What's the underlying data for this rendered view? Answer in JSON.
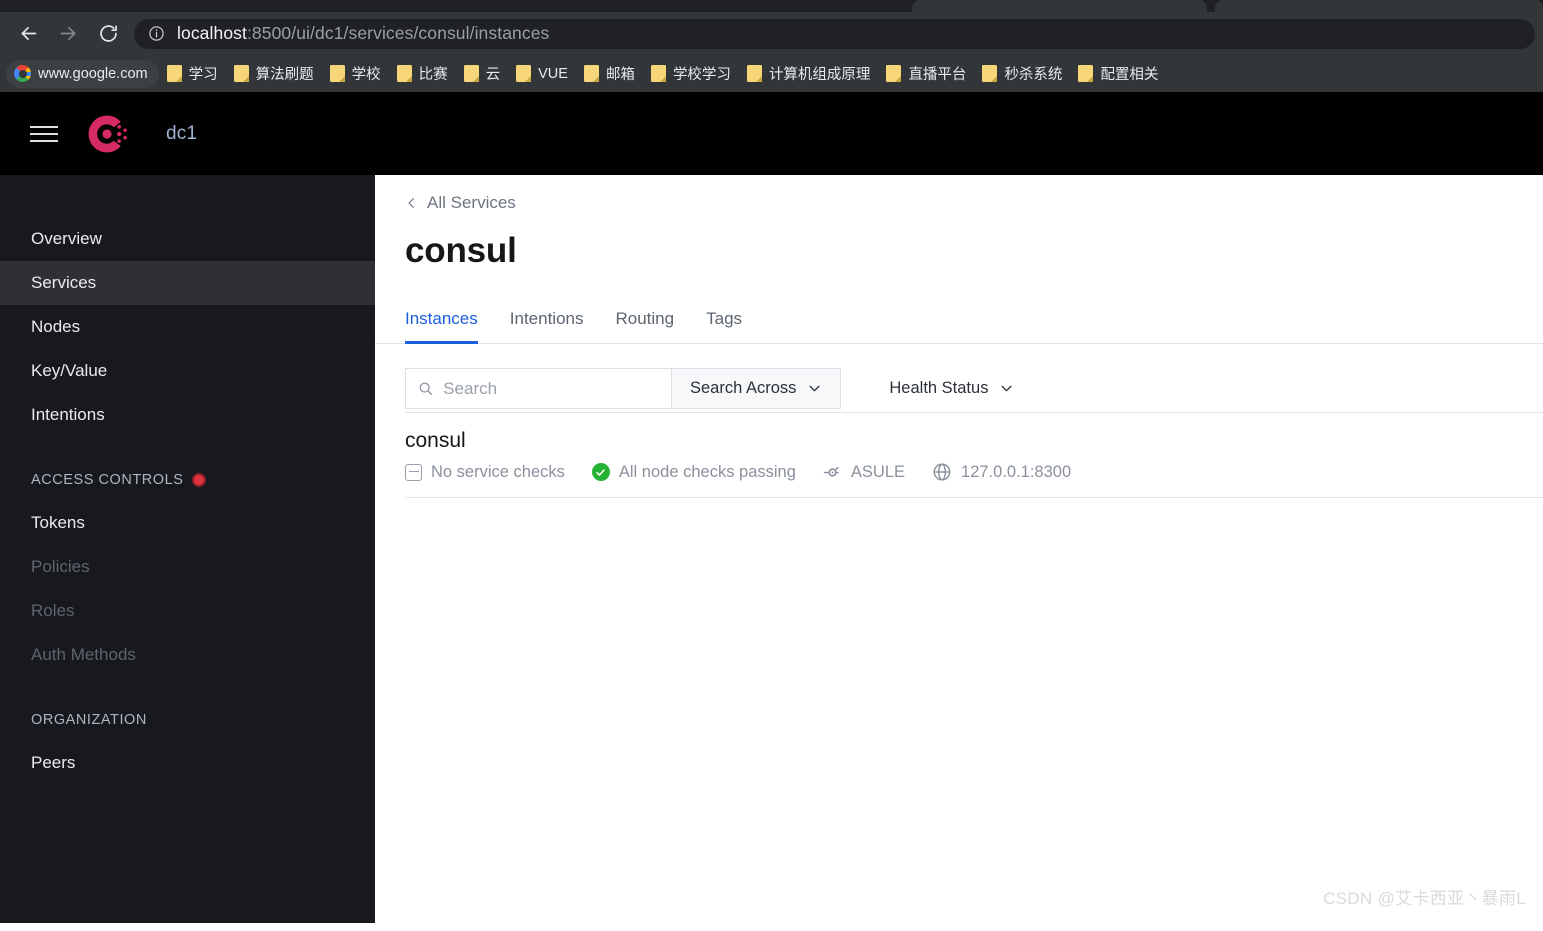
{
  "browser": {
    "nav": {
      "back_label": "Back",
      "forward_label": "Forward",
      "reload_label": "Reload"
    },
    "omnibox": {
      "info_icon": "site-information-icon",
      "url_host": "localhost",
      "url_rest": ":8500/ui/dc1/services/consul/instances",
      "url_full": "localhost:8500/ui/dc1/services/consul/instances"
    },
    "bookmarks": [
      {
        "label": "www.google.com",
        "icon": "google-logo-icon"
      },
      {
        "label": "学习",
        "icon": "folder-icon"
      },
      {
        "label": "算法刷题",
        "icon": "folder-icon"
      },
      {
        "label": "学校",
        "icon": "folder-icon"
      },
      {
        "label": "比赛",
        "icon": "folder-icon"
      },
      {
        "label": "云",
        "icon": "folder-icon"
      },
      {
        "label": "VUE",
        "icon": "folder-icon"
      },
      {
        "label": "邮箱",
        "icon": "folder-icon"
      },
      {
        "label": "学校学习",
        "icon": "folder-icon"
      },
      {
        "label": "计算机组成原理",
        "icon": "folder-icon"
      },
      {
        "label": "直播平台",
        "icon": "folder-icon"
      },
      {
        "label": "秒杀系统",
        "icon": "folder-icon"
      },
      {
        "label": "配置相关",
        "icon": "folder-icon"
      }
    ]
  },
  "app": {
    "header": {
      "menu_icon": "hamburger-menu-icon",
      "logo_icon": "consul-logo-icon",
      "datacenter": "dc1"
    },
    "sidebar": {
      "items": [
        {
          "label": "Overview",
          "state": "normal"
        },
        {
          "label": "Services",
          "state": "active"
        },
        {
          "label": "Nodes",
          "state": "normal"
        },
        {
          "label": "Key/Value",
          "state": "normal"
        },
        {
          "label": "Intentions",
          "state": "normal"
        }
      ],
      "access_controls": {
        "heading": "ACCESS CONTROLS",
        "badge_icon": "red-status-dot-icon",
        "items": [
          {
            "label": "Tokens",
            "state": "normal"
          },
          {
            "label": "Policies",
            "state": "disabled"
          },
          {
            "label": "Roles",
            "state": "disabled"
          },
          {
            "label": "Auth Methods",
            "state": "disabled"
          }
        ]
      },
      "organization": {
        "heading": "ORGANIZATION",
        "items": [
          {
            "label": "Peers",
            "state": "normal"
          }
        ]
      }
    },
    "main": {
      "breadcrumb": {
        "icon": "chevron-left-icon",
        "label": "All Services"
      },
      "title": "consul",
      "tabs": [
        {
          "label": "Instances",
          "active": true
        },
        {
          "label": "Intentions",
          "active": false
        },
        {
          "label": "Routing",
          "active": false
        },
        {
          "label": "Tags",
          "active": false
        }
      ],
      "filters": {
        "search_icon": "search-icon",
        "search_value": "",
        "search_placeholder": "Search",
        "search_across_label": "Search Across",
        "search_across_icon": "chevron-down-icon",
        "health_status_label": "Health Status",
        "health_status_icon": "chevron-down-icon"
      },
      "instances": [
        {
          "name": "consul",
          "service_checks": {
            "icon": "square-minus-icon",
            "label": "No service checks"
          },
          "node_checks": {
            "icon": "check-circle-icon",
            "label": "All node checks passing"
          },
          "node": {
            "icon": "node-icon",
            "label": "ASULE"
          },
          "address": {
            "icon": "globe-icon",
            "label": "127.0.0.1:8300"
          }
        }
      ]
    }
  },
  "watermark": "CSDN @艾卡西亚丶暴雨L",
  "colors": {
    "accent_blue": "#1c5fe0",
    "consul_pink": "#d62a65",
    "status_green": "#25b335",
    "status_red": "#e0333f",
    "chrome_dark": "#323639",
    "sidebar_dark": "#17191e",
    "header_black": "#000000"
  }
}
